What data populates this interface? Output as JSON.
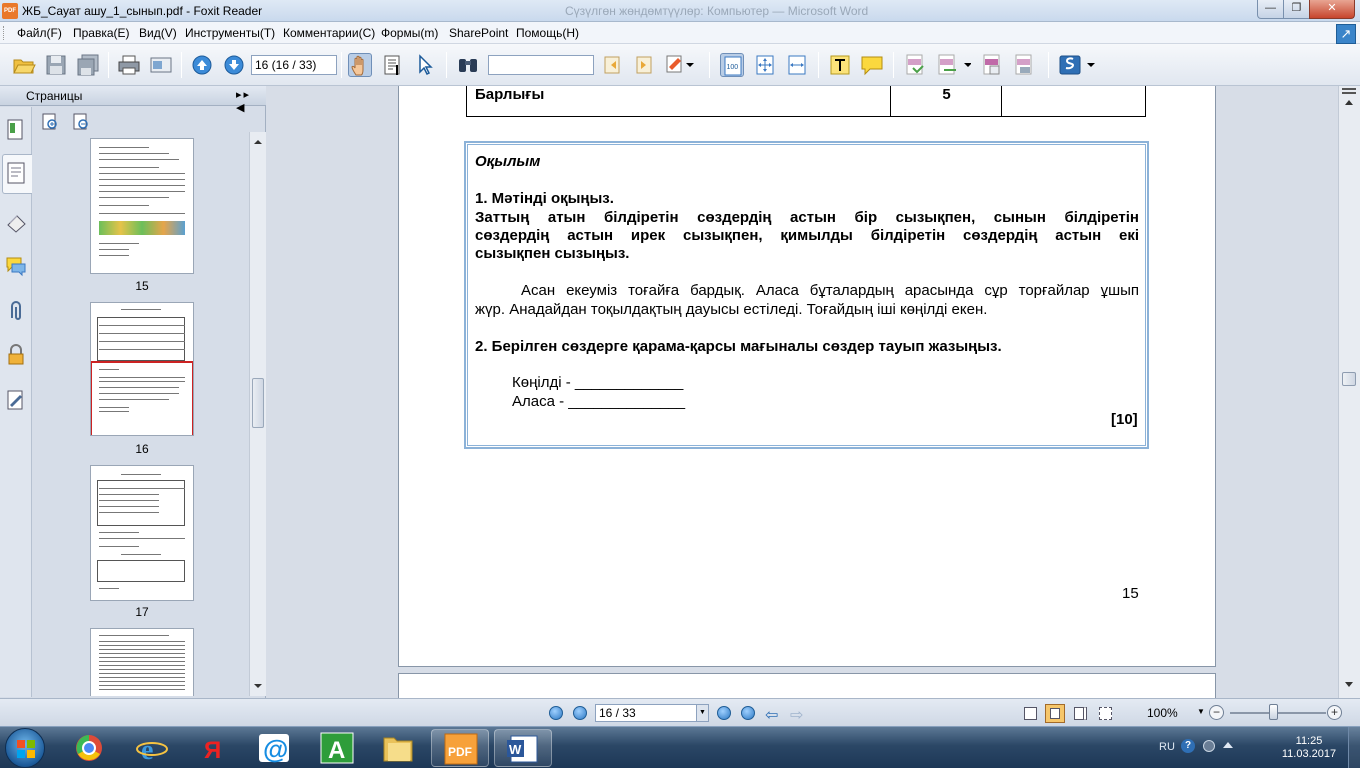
{
  "window": {
    "title": "ЖБ_Сауат ашу_1_сынып.pdf - Foxit Reader",
    "background_title": "Сүзүлгөн жөндөмтүүлөр: Компьютер — Microsoft Word",
    "app_icon_text": "PDF"
  },
  "menu": {
    "items": [
      "Файл(F)",
      "Правка(E)",
      "Вид(V)",
      "Инструменты(T)",
      "Комментарии(C)",
      "Формы(m)",
      "SharePoint",
      "Помощь(H)"
    ]
  },
  "toolbar": {
    "page_field": "16 (16 / 33)",
    "search_value": "",
    "icons": [
      "open-icon",
      "save-icon",
      "save-all-icon",
      "print-icon",
      "email-icon",
      "prev-page-icon",
      "next-page-icon",
      "hand-tool-icon",
      "select-text-icon",
      "select-icon",
      "find-icon",
      "search-prev-icon",
      "search-next-icon",
      "highlight-icon",
      "actual-size-icon",
      "fit-page-icon",
      "fit-width-icon",
      "typewriter-icon",
      "note-icon",
      "create-pdf-icon",
      "convert-icon",
      "pdf-icon",
      "pdf2-icon",
      "sharepoint-icon"
    ]
  },
  "sidebar": {
    "title": "Страницы",
    "thumbnails": [
      {
        "label": "15",
        "selected": false
      },
      {
        "label": "16",
        "selected": true
      },
      {
        "label": "17",
        "selected": false
      },
      {
        "label": "",
        "selected": false
      }
    ]
  },
  "document": {
    "table_label": "Барлығы",
    "table_score": "5",
    "section_title": "Оқылым",
    "task1_title": "1. Мәтінді оқыңыз.",
    "task1_line1": "Заттың атын білдіретін сөздердің астын бір сызықпен, сынын білдіретін",
    "task1_line2": "сөздердің астын ирек сызықпен, қимылды білдіретін сөздердің астын екі",
    "task1_line3": "сызықпен сызыңыз.",
    "text_line1": "Асан екеуміз тоғайға бардық. Аласа бұталардың арасында сұр торғайлар  ұшып",
    "text_line2": "жүр. Анадайдан тоқылдақтың дауысы естіледі. Тоғайдың  іші көңілді екен.",
    "task2_title": "2. Берілген сөздерге  қарама-қарсы мағыналы сөздер тауып жазыңыз.",
    "word1": "Көңілді - _____________",
    "word2": "Аласа -  ______________",
    "score": "[10]",
    "page_number": "15"
  },
  "statusbar": {
    "page_field": "16 / 33",
    "zoom": "100%"
  },
  "taskbar": {
    "apps": [
      "chrome-icon",
      "ie-icon",
      "yandex-icon",
      "mail-icon",
      "a-icon",
      "folder-icon",
      "foxit-icon",
      "word-icon"
    ],
    "lang": "RU",
    "time": "11:25",
    "date": "11.03.2017"
  },
  "colors": {
    "box_border": "#8cb2d8",
    "selected_thumb": "#cc2222",
    "taskbar": "#2b4766"
  }
}
